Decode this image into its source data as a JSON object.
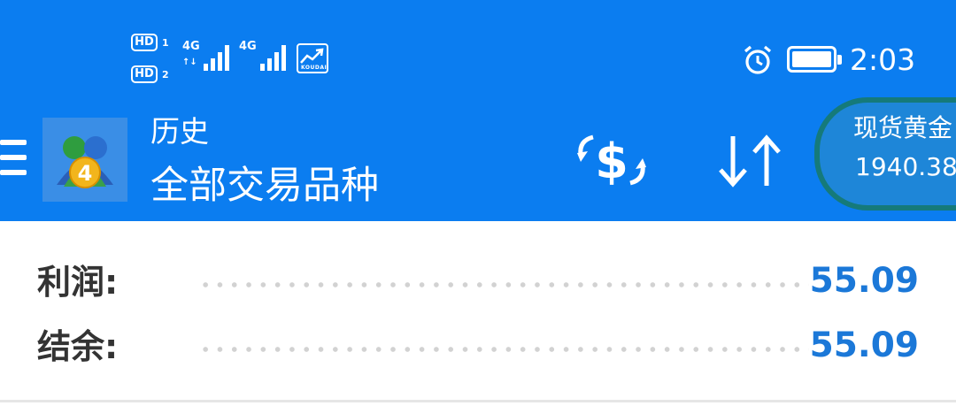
{
  "status_bar": {
    "sim1": {
      "badge": "HD",
      "num": "1",
      "network": "4G"
    },
    "sim2": {
      "badge": "HD",
      "num": "2",
      "network": "4G"
    },
    "app_icon_text": "KOUDAI",
    "time": "2:03",
    "icons": [
      "alarm-icon",
      "battery-icon",
      "signal-icon",
      "stock-app-icon"
    ]
  },
  "header": {
    "title": "历史",
    "subtitle": "全部交易品种",
    "icons": [
      "menu-icon",
      "app-logo-icon",
      "currency-exchange-icon",
      "sort-icon"
    ]
  },
  "quote_widget": {
    "symbol": "现货黄金",
    "price": "1940.38"
  },
  "summary": [
    {
      "label": "利润:",
      "value": "55.09"
    },
    {
      "label": "结余:",
      "value": "55.09"
    }
  ],
  "colors": {
    "header_blue": "#0b7df0",
    "value_blue": "#1b78d8",
    "label_text": "#333333",
    "dot_gray": "#d2d2d2"
  }
}
